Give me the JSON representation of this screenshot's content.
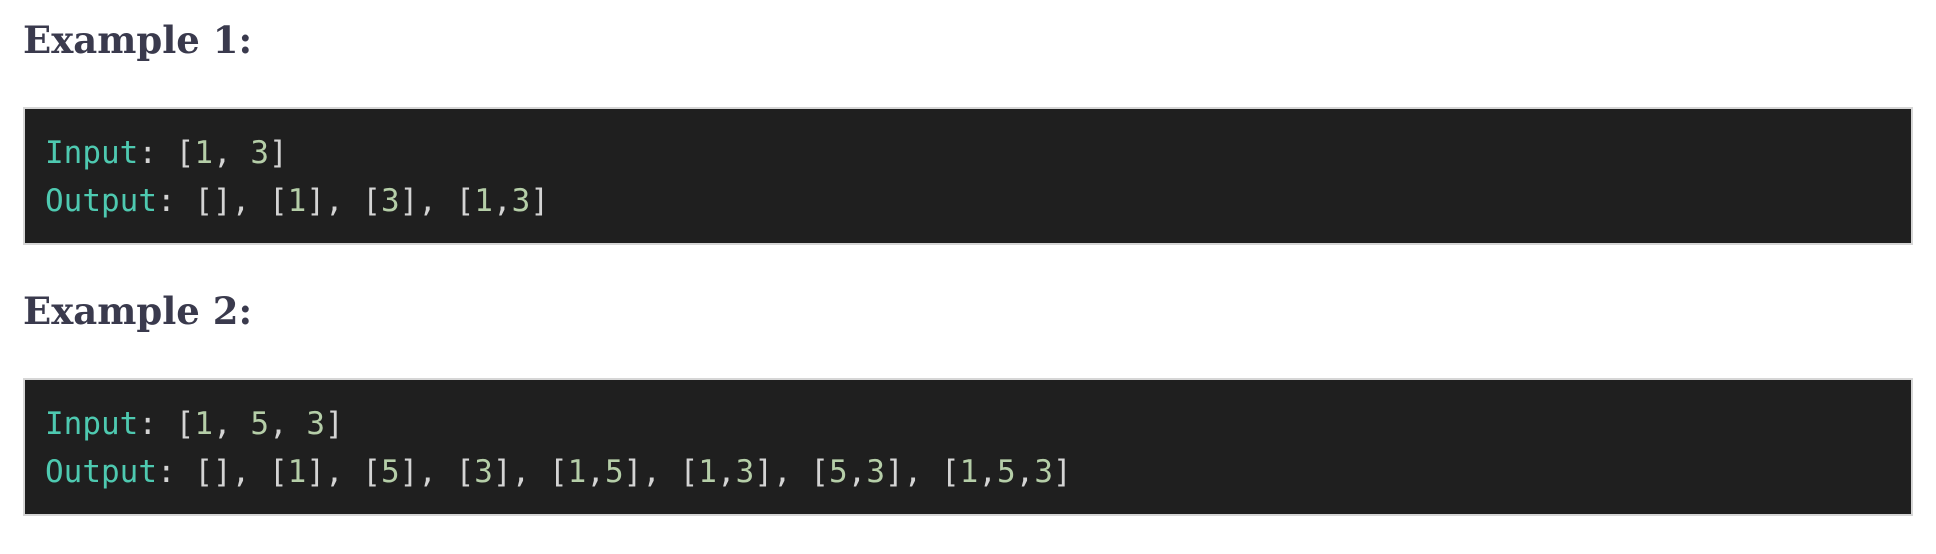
{
  "examples": [
    {
      "heading": "Example 1:",
      "input_label": "Input",
      "input_value_tokens": [
        {
          "t": "[",
          "k": "punct"
        },
        {
          "t": "1",
          "k": "num"
        },
        {
          "t": ", ",
          "k": "punct"
        },
        {
          "t": "3",
          "k": "num"
        },
        {
          "t": "]",
          "k": "punct"
        }
      ],
      "output_label": "Output",
      "output_value_tokens": [
        {
          "t": "[], [",
          "k": "punct"
        },
        {
          "t": "1",
          "k": "num"
        },
        {
          "t": "], [",
          "k": "punct"
        },
        {
          "t": "3",
          "k": "num"
        },
        {
          "t": "], [",
          "k": "punct"
        },
        {
          "t": "1",
          "k": "num"
        },
        {
          "t": ",",
          "k": "punct"
        },
        {
          "t": "3",
          "k": "num"
        },
        {
          "t": "]",
          "k": "punct"
        }
      ]
    },
    {
      "heading": "Example 2:",
      "input_label": "Input",
      "input_value_tokens": [
        {
          "t": "[",
          "k": "punct"
        },
        {
          "t": "1",
          "k": "num"
        },
        {
          "t": ", ",
          "k": "punct"
        },
        {
          "t": "5",
          "k": "num"
        },
        {
          "t": ", ",
          "k": "punct"
        },
        {
          "t": "3",
          "k": "num"
        },
        {
          "t": "]",
          "k": "punct"
        }
      ],
      "output_label": "Output",
      "output_value_tokens": [
        {
          "t": "[], [",
          "k": "punct"
        },
        {
          "t": "1",
          "k": "num"
        },
        {
          "t": "], [",
          "k": "punct"
        },
        {
          "t": "5",
          "k": "num"
        },
        {
          "t": "], [",
          "k": "punct"
        },
        {
          "t": "3",
          "k": "num"
        },
        {
          "t": "], [",
          "k": "punct"
        },
        {
          "t": "1",
          "k": "num"
        },
        {
          "t": ",",
          "k": "punct"
        },
        {
          "t": "5",
          "k": "num"
        },
        {
          "t": "], [",
          "k": "punct"
        },
        {
          "t": "1",
          "k": "num"
        },
        {
          "t": ",",
          "k": "punct"
        },
        {
          "t": "3",
          "k": "num"
        },
        {
          "t": "], [",
          "k": "punct"
        },
        {
          "t": "5",
          "k": "num"
        },
        {
          "t": ",",
          "k": "punct"
        },
        {
          "t": "3",
          "k": "num"
        },
        {
          "t": "], [",
          "k": "punct"
        },
        {
          "t": "1",
          "k": "num"
        },
        {
          "t": ",",
          "k": "punct"
        },
        {
          "t": "5",
          "k": "num"
        },
        {
          "t": ",",
          "k": "punct"
        },
        {
          "t": "3",
          "k": "num"
        },
        {
          "t": "]",
          "k": "punct"
        }
      ]
    }
  ],
  "separator": ": ",
  "colors": {
    "heading": "#3a3a4d",
    "code_background": "#1f1f1f",
    "code_border": "#d6d6d6",
    "keyword": "#4ec9b0",
    "number": "#b5cea8",
    "punctuation": "#d4d4d4"
  }
}
